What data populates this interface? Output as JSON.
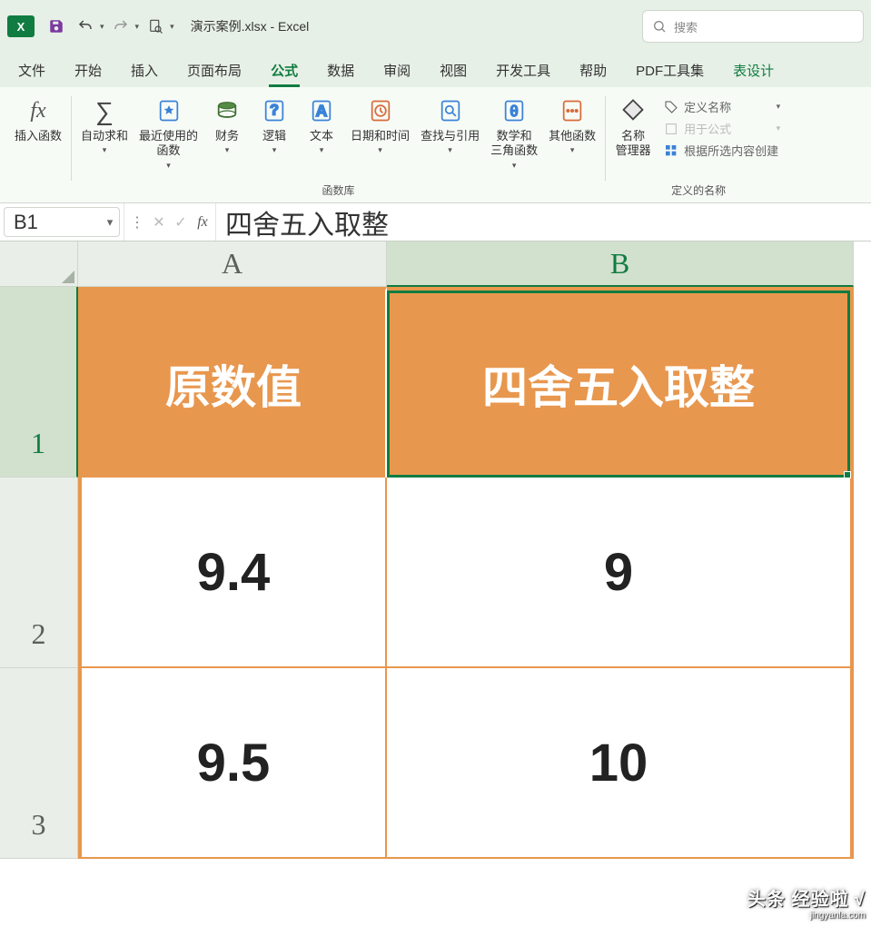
{
  "app": {
    "title": "演示案例.xlsx - Excel",
    "icon_text": "X",
    "search_placeholder": "搜索"
  },
  "qat": {
    "overflow_caret": "▾"
  },
  "tabs": [
    {
      "key": "file",
      "label": "文件"
    },
    {
      "key": "home",
      "label": "开始"
    },
    {
      "key": "insert",
      "label": "插入"
    },
    {
      "key": "layout",
      "label": "页面布局"
    },
    {
      "key": "formulas",
      "label": "公式"
    },
    {
      "key": "data",
      "label": "数据"
    },
    {
      "key": "review",
      "label": "审阅"
    },
    {
      "key": "view",
      "label": "视图"
    },
    {
      "key": "dev",
      "label": "开发工具"
    },
    {
      "key": "help",
      "label": "帮助"
    },
    {
      "key": "pdf",
      "label": "PDF工具集"
    },
    {
      "key": "tabledesign",
      "label": "表设计"
    }
  ],
  "ribbon": {
    "insert_fn": {
      "label": "插入函数"
    },
    "lib_group_label": "函数库",
    "autosum": {
      "label": "自动求和"
    },
    "recent": {
      "label_line1": "最近使用的",
      "label_line2": "函数"
    },
    "financial": {
      "label": "财务"
    },
    "logical": {
      "label": "逻辑"
    },
    "text": {
      "label": "文本"
    },
    "datetime": {
      "label": "日期和时间"
    },
    "lookup": {
      "label": "查找与引用"
    },
    "mathtrig": {
      "label_line1": "数学和",
      "label_line2": "三角函数"
    },
    "more": {
      "label": "其他函数"
    },
    "namemgr": {
      "label_line1": "名称",
      "label_line2": "管理器"
    },
    "names_group_label": "定义的名称",
    "define_name": {
      "label": "定义名称"
    },
    "use_in_formula": {
      "label": "用于公式"
    },
    "create_from_sel": {
      "label": "根据所选内容创建"
    }
  },
  "formula_bar": {
    "cell_ref": "B1",
    "value": "四舍五入取整"
  },
  "grid": {
    "columns": [
      "A",
      "B"
    ],
    "rows": [
      "1",
      "2",
      "3"
    ],
    "headers": {
      "A": "原数值",
      "B": "四舍五入取整"
    },
    "data": [
      {
        "a": "9.4",
        "b": "9"
      },
      {
        "a": "9.5",
        "b": "10"
      }
    ],
    "selected_cell": "B1"
  },
  "watermark": {
    "text": "头条 经验啦 √",
    "sub": "jingyanla.com"
  }
}
